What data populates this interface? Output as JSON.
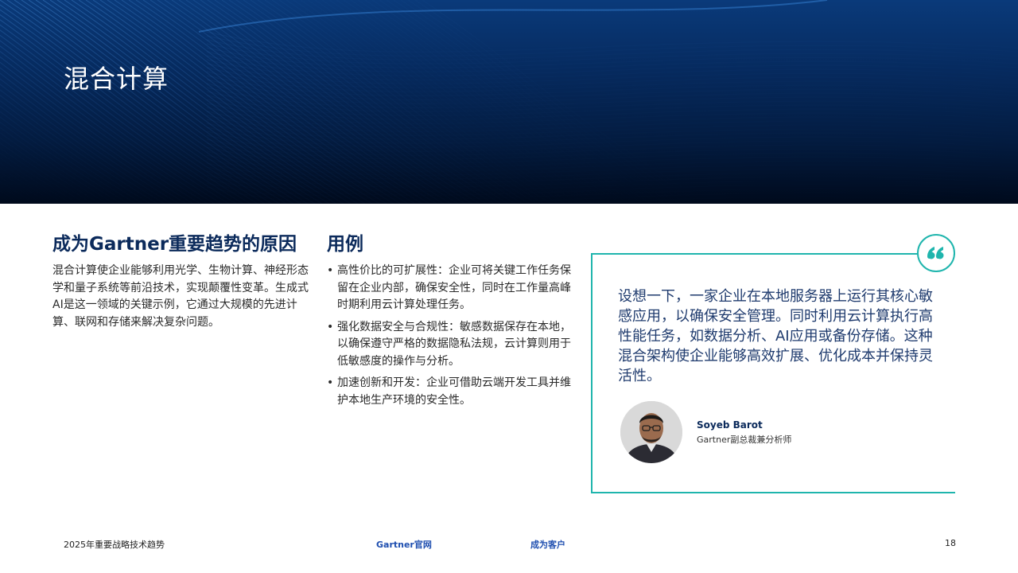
{
  "banner": {
    "title": "混合计算"
  },
  "left": {
    "heading": "成为Gartner重要趋势的原因",
    "body": "混合计算使企业能够利用光学、生物计算、神经形态学和量子系统等前沿技术，实现颠覆性变革。生成式AI是这一领域的关键示例，它通过大规模的先进计算、联网和存储来解决复杂问题。"
  },
  "middle": {
    "heading": "用例",
    "bullets": [
      "高性价比的可扩展性：企业可将关键工作任务保留在企业内部，确保安全性，同时在工作量高峰时期利用云计算处理任务。",
      "强化数据安全与合规性：敏感数据保存在本地，以确保遵守严格的数据隐私法规，云计算则用于低敏感度的操作与分析。",
      "加速创新和开发：企业可借助云端开发工具并维护本地生产环境的安全性。"
    ]
  },
  "quote": {
    "text": "设想一下，一家企业在本地服务器上运行其核心敏感应用，以确保安全管理。同时利用云计算执行高性能任务，如数据分析、AI应用或备份存储。这种混合架构使企业能够高效扩展、优化成本并保持灵活性。",
    "person_name": "Soyeb Barot",
    "person_role": "Gartner副总裁兼分析师",
    "accent_color": "#1fb5ad"
  },
  "footer": {
    "left": "2025年重要战略技术趋势",
    "link1": "Gartner官网",
    "link2": "成为客户",
    "page": "18"
  }
}
